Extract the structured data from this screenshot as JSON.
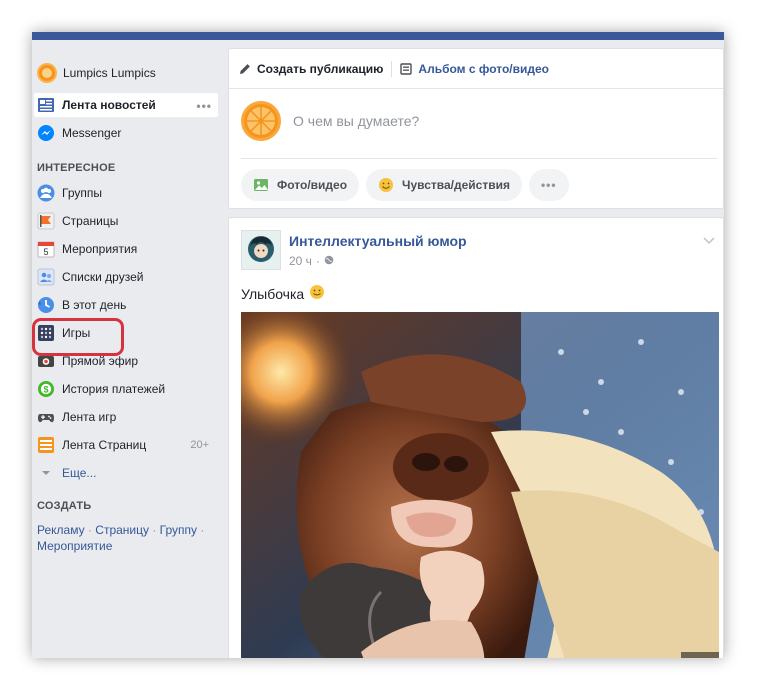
{
  "profile": {
    "name": "Lumpics Lumpics"
  },
  "sidebar": {
    "news_feed": {
      "label": "Лента новостей",
      "more": "•••"
    },
    "messenger": {
      "label": "Messenger"
    },
    "section_interesting": "ИНТЕРЕСНОЕ",
    "items": [
      {
        "label": "Группы"
      },
      {
        "label": "Страницы"
      },
      {
        "label": "Мероприятия"
      },
      {
        "label": "Списки друзей"
      },
      {
        "label": "В этот день"
      },
      {
        "label": "Игры"
      },
      {
        "label": "Прямой эфир"
      },
      {
        "label": "История платежей"
      },
      {
        "label": "Лента игр"
      },
      {
        "label": "Лента Страниц",
        "count": "20+"
      }
    ],
    "more_link": "Еще...",
    "calendar_day": "5",
    "section_create": "СОЗДАТЬ",
    "create_links": [
      "Рекламу",
      "Страницу",
      "Группу",
      "Мероприятие"
    ],
    "create_separator": " · "
  },
  "composer": {
    "tab_create": "Создать публикацию",
    "tab_album": "Альбом с фото/видео",
    "placeholder": "О чем вы думаете?",
    "photo_button": "Фото/видео",
    "feelings_button": "Чувства/действия",
    "more_button": "•••"
  },
  "post": {
    "author": "Интеллектуальный юмор",
    "time": "20 ч",
    "meta_dot": "·",
    "text": "Улыбочка"
  },
  "colors": {
    "brand_blue": "#3b5998",
    "link_blue": "#365899",
    "highlight_red": "#d6333f",
    "background": "#e9ebee"
  }
}
